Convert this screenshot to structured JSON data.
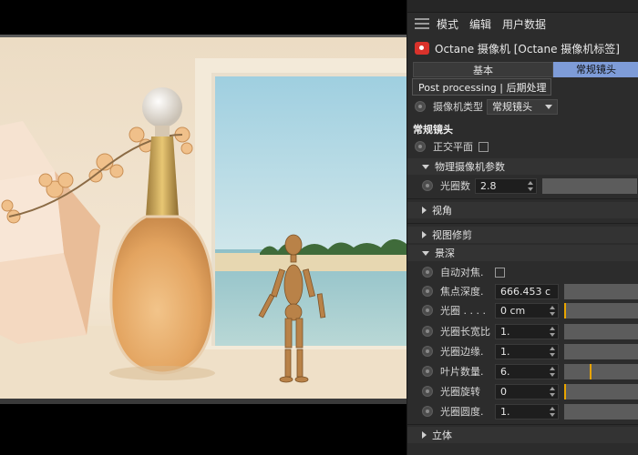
{
  "menu": {
    "items": [
      "模式",
      "编辑",
      "用户数据"
    ]
  },
  "object": {
    "title": "Octane 摄像机 [Octane 摄像机标签]"
  },
  "tabs": {
    "basic": "基本",
    "lens": "常规镜头"
  },
  "tooltip": "Post processing | 后期处理",
  "camera_type": {
    "label": "摄像机类型",
    "value": "常规镜头"
  },
  "headings": {
    "regular_lens": "常规镜头"
  },
  "ortho": {
    "label": "正交平面"
  },
  "physical": {
    "section": "物理摄像机参数",
    "aperture_label": "光圈数",
    "aperture_value": "2.8"
  },
  "sections": {
    "view_angle": "视角",
    "view_edit": "视图修剪",
    "dof": "景深",
    "stereo": "立体"
  },
  "dof": {
    "auto_focus_label": "自动对焦.",
    "focal_depth_label": "焦点深度.",
    "focal_depth_value": "666.453 c",
    "aperture_label": "光圈 . . . .",
    "aperture_value": "0 cm",
    "aspect_label": "光圈长宽比",
    "aspect_value": "1.",
    "edge_label": "光圈边缘.",
    "edge_value": "1.",
    "blades_label": "叶片数量.",
    "blades_value": "6.",
    "rotation_label": "光圈旋转",
    "rotation_value": "0",
    "roundness_label": "光圈圆度.",
    "roundness_value": "1."
  },
  "colors": {
    "accent_tab": "#7e9cd8",
    "slider_mark": "#e8a400",
    "camera_icon": "#d9322b"
  }
}
